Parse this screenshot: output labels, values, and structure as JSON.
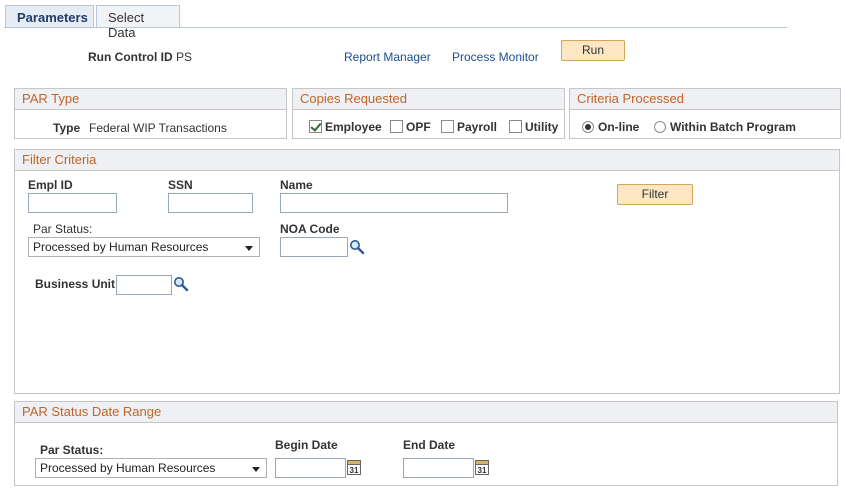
{
  "tabs": {
    "parameters": "Parameters",
    "select_data": "Select Data"
  },
  "run_control": {
    "label": "Run Control ID",
    "value": "PS"
  },
  "links": {
    "report_manager": "Report Manager",
    "process_monitor": "Process Monitor"
  },
  "buttons": {
    "run": "Run",
    "filter": "Filter"
  },
  "par_type": {
    "title": "PAR Type",
    "label": "Type",
    "value": "Federal WIP Transactions"
  },
  "copies_requested": {
    "title": "Copies Requested",
    "employee": "Employee",
    "opf": "OPF",
    "payroll": "Payroll",
    "utility": "Utility",
    "employee_checked": true,
    "opf_checked": false,
    "payroll_checked": false,
    "utility_checked": false
  },
  "criteria_processed": {
    "title": "Criteria Processed",
    "online": "On-line",
    "within_batch": "Within Batch Program",
    "selected": "online"
  },
  "filter_criteria": {
    "title": "Filter Criteria",
    "empl_id_label": "Empl ID",
    "ssn_label": "SSN",
    "name_label": "Name",
    "par_status_label": "Par Status:",
    "par_status_value": "Processed by Human Resources",
    "noa_code_label": "NOA Code",
    "business_unit_label": "Business Unit"
  },
  "par_status_date_range": {
    "title": "PAR Status Date Range",
    "par_status_label": "Par Status:",
    "par_status_value": "Processed by Human Resources",
    "begin_date_label": "Begin Date",
    "end_date_label": "End Date"
  },
  "calendar_day": "31"
}
